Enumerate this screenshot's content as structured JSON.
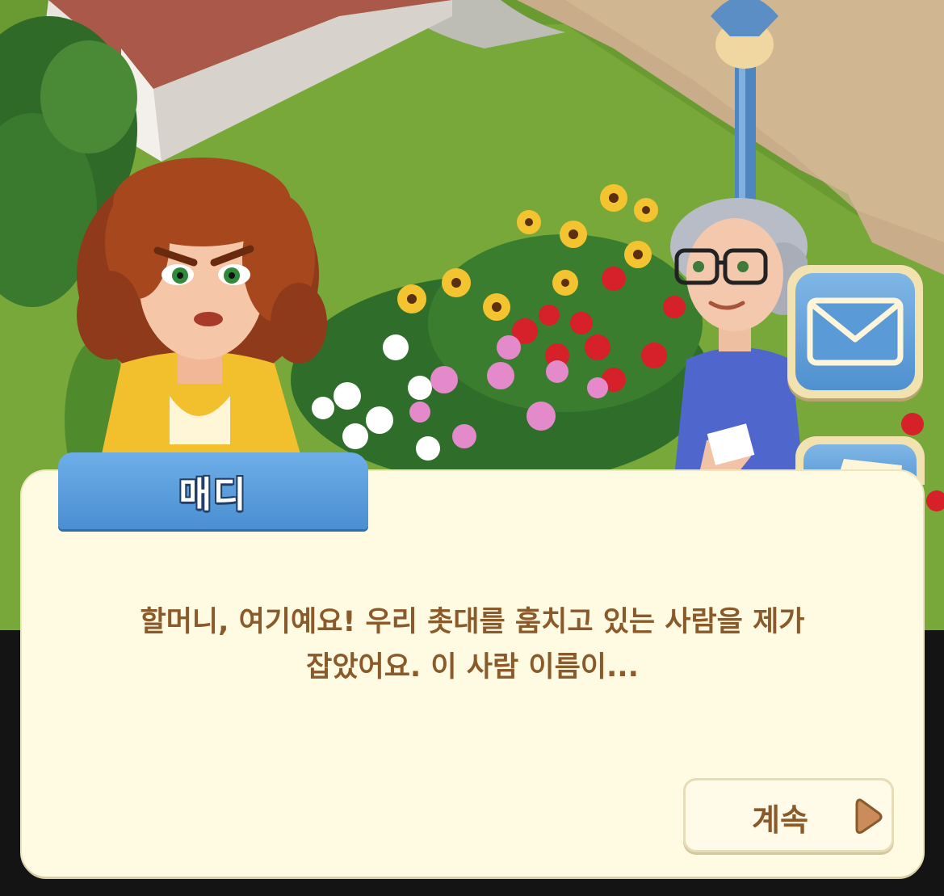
{
  "dialog": {
    "speaker_name": "매디",
    "line1": "할머니, 여기예요! 우리 촛대를 훔치고 있는 사람을 제가",
    "line2": "잡았어요. 이 사람 이름이...",
    "continue_label": "계속"
  },
  "icons": {
    "side_button_top": "mail-icon",
    "side_button_bottom": "letter-icon",
    "continue": "play-arrow-icon"
  },
  "colors": {
    "name_tab": "#4a8fd2",
    "dialog_bg": "#fffbe2",
    "text": "#8a5a2a",
    "arrow": "#c98c5a"
  }
}
